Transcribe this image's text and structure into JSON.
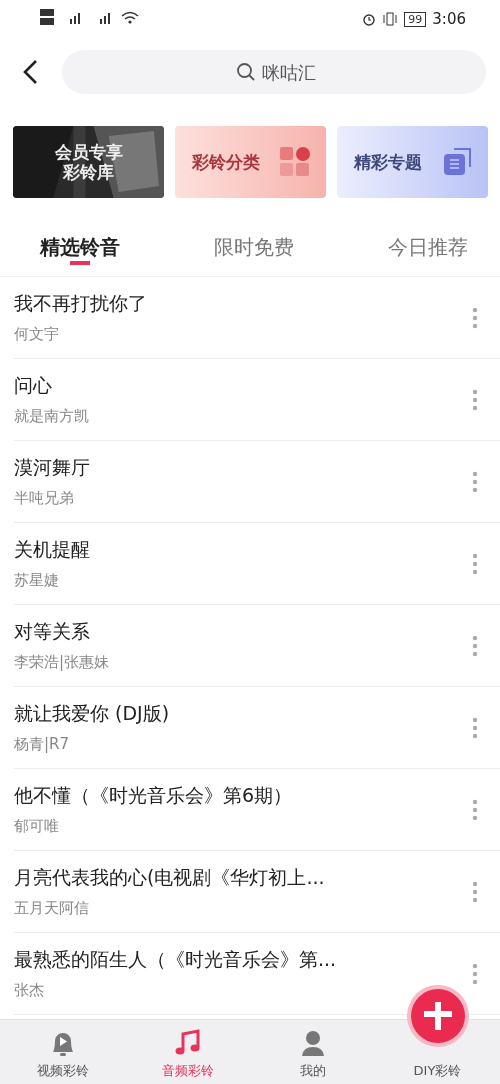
{
  "status_bar": {
    "battery": "99",
    "time": "3:06"
  },
  "search": {
    "placeholder": "咪咕汇"
  },
  "banners": [
    {
      "lines": [
        "会员专享",
        "彩铃库"
      ]
    },
    {
      "kind": "category",
      "lines": [
        "彩铃分类"
      ]
    },
    {
      "kind": "topic",
      "lines": [
        "精彩专题"
      ]
    }
  ],
  "tabs": [
    {
      "label": "精选铃音",
      "selected": true
    },
    {
      "label": "限时免费",
      "selected": false
    },
    {
      "label": "今日推荐",
      "selected": false
    }
  ],
  "songs": [
    {
      "title": "我不再打扰你了",
      "artist": "何文宇"
    },
    {
      "title": "问心",
      "artist": "就是南方凯"
    },
    {
      "title": "漠河舞厅",
      "artist": "半吨兄弟"
    },
    {
      "title": "关机提醒",
      "artist": "苏星婕"
    },
    {
      "title": "对等关系",
      "artist": "李荣浩|张惠妹"
    },
    {
      "title": "就让我爱你 (DJ版)",
      "artist": "杨青|R7"
    },
    {
      "title": "他不懂（《时光音乐会》第6期）",
      "artist": "郁可唯"
    },
    {
      "title": "月亮代表我的心(电视剧《华灯初上...",
      "artist": "五月天阿信"
    },
    {
      "title": "最熟悉的陌生人（《时光音乐会》第...",
      "artist": "张杰"
    }
  ],
  "nav": [
    {
      "label": "视频彩铃",
      "kind": "bell",
      "selected": false
    },
    {
      "label": "音频彩铃",
      "kind": "music",
      "selected": true
    },
    {
      "label": "我的",
      "kind": "person",
      "selected": false
    },
    {
      "label": "DIY彩铃",
      "kind": "add",
      "selected": false
    }
  ]
}
